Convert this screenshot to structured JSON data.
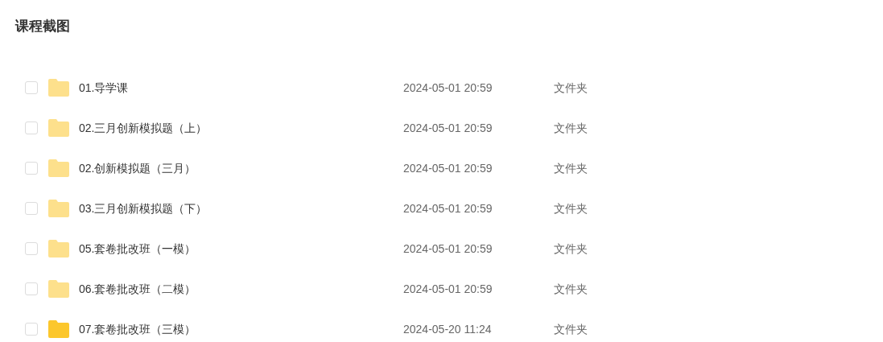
{
  "title": "课程截图",
  "files": [
    {
      "name": "01.导学课",
      "modified": "2024-05-01 20:59",
      "type": "文件夹",
      "checked": false,
      "color": "#fde08c"
    },
    {
      "name": "02.三月创新模拟题（上）",
      "modified": "2024-05-01 20:59",
      "type": "文件夹",
      "checked": false,
      "color": "#fde08c"
    },
    {
      "name": "02.创新模拟题（三月）",
      "modified": "2024-05-01 20:59",
      "type": "文件夹",
      "checked": false,
      "color": "#fde08c"
    },
    {
      "name": "03.三月创新模拟题（下）",
      "modified": "2024-05-01 20:59",
      "type": "文件夹",
      "checked": false,
      "color": "#fde08c"
    },
    {
      "name": "05.套卷批改班（一模）",
      "modified": "2024-05-01 20:59",
      "type": "文件夹",
      "checked": false,
      "color": "#fde08c"
    },
    {
      "name": "06.套卷批改班（二模）",
      "modified": "2024-05-01 20:59",
      "type": "文件夹",
      "checked": false,
      "color": "#fde08c"
    },
    {
      "name": "07.套卷批改班（三模）",
      "modified": "2024-05-20 11:24",
      "type": "文件夹",
      "checked": false,
      "color": "#fcc72c"
    }
  ]
}
